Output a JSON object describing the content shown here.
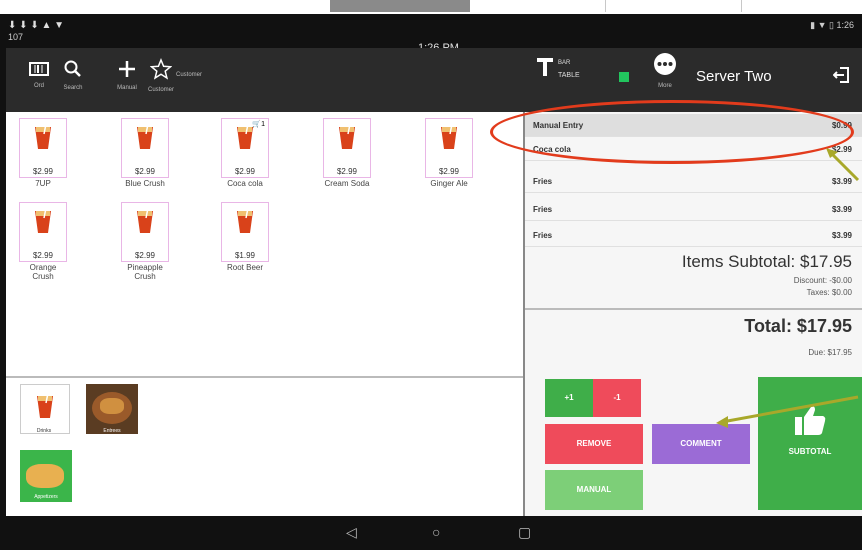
{
  "status_bar": {
    "icons_left": "⬇ ⬇ ⬇ ▲ ▼",
    "order_number": "107",
    "time": "1:26 PM",
    "icons_right": "▮ ▼ ▯ 1:26"
  },
  "toolbar": {
    "items": [
      {
        "label": "Ord",
        "icon": "barcode-icon"
      },
      {
        "label": "Search",
        "icon": "search-icon"
      },
      {
        "label": "Manual",
        "icon": "plus-icon"
      },
      {
        "label": "Customer",
        "icon": "star-icon",
        "caption": "Customer"
      }
    ],
    "bar_table": {
      "line1": "BAR",
      "line2": "TABLE"
    },
    "more_label": "More",
    "server_name": "Server Two",
    "status_color": "#22c55e"
  },
  "products": [
    {
      "price": "$2.99",
      "name": "7UP"
    },
    {
      "price": "$2.99",
      "name": "Blue Crush"
    },
    {
      "price": "$2.99",
      "name": "Coca cola",
      "badge": "1"
    },
    {
      "price": "$2.99",
      "name": "Cream Soda"
    },
    {
      "price": "$2.99",
      "name": "Ginger Ale"
    },
    {
      "price": "$2.99",
      "name": "Orange Crush"
    },
    {
      "price": "$2.99",
      "name": "Pineapple Crush"
    },
    {
      "price": "$1.99",
      "name": "Root Beer"
    }
  ],
  "categories": [
    {
      "name": "Drinks"
    },
    {
      "name": "Entrees"
    },
    {
      "name": "Appetizers"
    }
  ],
  "order": {
    "items": [
      {
        "name": "Manual Entry",
        "price": "$0.99"
      },
      {
        "name": "Coca cola",
        "price": "$2.99"
      },
      {
        "name": "Fries",
        "price": "$3.99"
      },
      {
        "name": "Fries",
        "price": "$3.99"
      },
      {
        "name": "Fries",
        "price": "$3.99"
      }
    ],
    "items_subtotal": "Items Subtotal: $17.95",
    "discount": "Discount: -$0.00",
    "taxes": "Taxes: $0.00",
    "total": "Total: $17.95",
    "due": "Due: $17.95"
  },
  "buttons": {
    "plus_one": "+1",
    "minus_one": "-1",
    "remove": "REMOVE",
    "comment": "COMMENT",
    "manual": "MANUAL",
    "subtotal": "SUBTOTAL"
  },
  "colors": {
    "green": "#3fae49",
    "red": "#ef4b5b",
    "purple": "#9b6bd6",
    "light_green": "#7dcf78",
    "annotation_red": "#e23b1c",
    "annotation_arrow": "#a8a82a"
  }
}
